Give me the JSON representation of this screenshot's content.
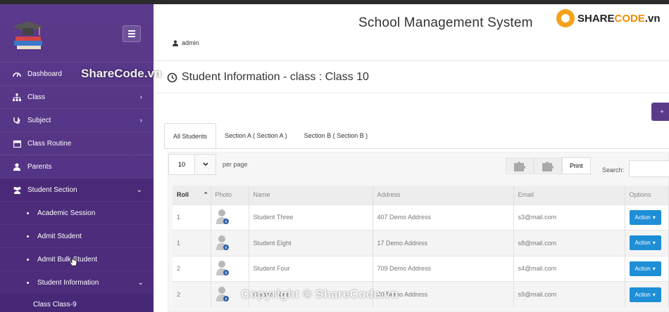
{
  "app": {
    "title": "School Management System",
    "user": "admin"
  },
  "brand": {
    "name_prefix": "SHARE",
    "name_suffix": "CODE",
    "tld": ".vn"
  },
  "sidebar": {
    "items": [
      {
        "label": "Dashboard",
        "icon": "gauge-icon"
      },
      {
        "label": "Class",
        "icon": "sitemap-icon",
        "chevron": "›"
      },
      {
        "label": "Subject",
        "icon": "stethoscope-icon",
        "chevron": "›"
      },
      {
        "label": "Class Routine",
        "icon": "calendar-icon"
      },
      {
        "label": "Parents",
        "icon": "user-icon"
      },
      {
        "label": "Student Section",
        "icon": "users-icon",
        "chevron": "⌄"
      }
    ],
    "sub_items": [
      {
        "label": "Academic Session"
      },
      {
        "label": "Admit Student"
      },
      {
        "label": "Admit Bulk Student"
      },
      {
        "label": "Student Information",
        "chevron": "⌄"
      }
    ],
    "sub_sub_items": [
      {
        "label": "Class Class-9"
      }
    ]
  },
  "page": {
    "title": "Student Information - class : Class 10",
    "add_button": "+"
  },
  "tabs": [
    {
      "label": "All Students",
      "active": true
    },
    {
      "label": "Section A ( Section A )",
      "active": false
    },
    {
      "label": "Section B ( Section B )",
      "active": false
    }
  ],
  "table_controls": {
    "per_page_value": "10",
    "per_page_label": "per page",
    "print_label": "Print",
    "search_label": "Search:"
  },
  "table": {
    "columns": [
      "Roll",
      "Photo",
      "Name",
      "Address",
      "Email",
      "Options"
    ],
    "rows": [
      {
        "roll": "1",
        "name": "Student Three",
        "address": "407 Demo Address",
        "email": "s3@mail.com",
        "action": "Action"
      },
      {
        "roll": "1",
        "name": "Student Eight",
        "address": "17 Demo Address",
        "email": "s8@mail.com",
        "action": "Action"
      },
      {
        "roll": "2",
        "name": "Student Four",
        "address": "709 Demo Address",
        "email": "s4@mail.com",
        "action": "Action"
      },
      {
        "roll": "2",
        "name": "Student Nine",
        "address": "70 Demo Address",
        "email": "s9@mail.com",
        "action": "Action"
      }
    ]
  },
  "watermarks": {
    "top": "ShareCode.vn",
    "bottom": "Copyright © ShareCode.vn"
  },
  "colors": {
    "sidebar": "#5b3a8c",
    "accent": "#1e8ed6",
    "brand_orange": "#f08c00"
  }
}
